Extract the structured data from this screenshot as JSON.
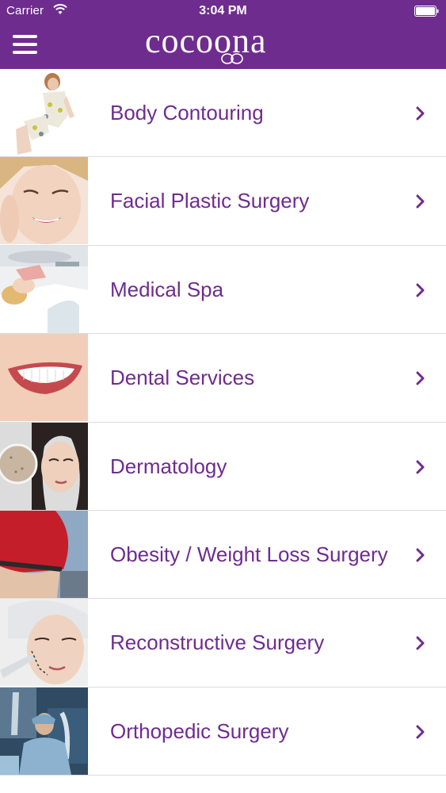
{
  "status_bar": {
    "carrier": "Carrier",
    "time": "3:04 PM"
  },
  "header": {
    "logo_text": "cocoona",
    "background_color": "#6f2c8f"
  },
  "list": {
    "accent_color": "#6f2c8f",
    "items": [
      {
        "label": "Body Contouring",
        "icon": "body-contouring-photo"
      },
      {
        "label": "Facial Plastic Surgery",
        "icon": "facial-plastic-surgery-photo"
      },
      {
        "label": "Medical Spa",
        "icon": "medical-spa-photo"
      },
      {
        "label": "Dental Services",
        "icon": "dental-services-photo"
      },
      {
        "label": "Dermatology",
        "icon": "dermatology-photo"
      },
      {
        "label": "Obesity / Weight Loss Surgery",
        "icon": "weight-loss-photo"
      },
      {
        "label": "Reconstructive Surgery",
        "icon": "reconstructive-surgery-photo"
      },
      {
        "label": "Orthopedic Surgery",
        "icon": "orthopedic-surgery-photo"
      }
    ]
  }
}
